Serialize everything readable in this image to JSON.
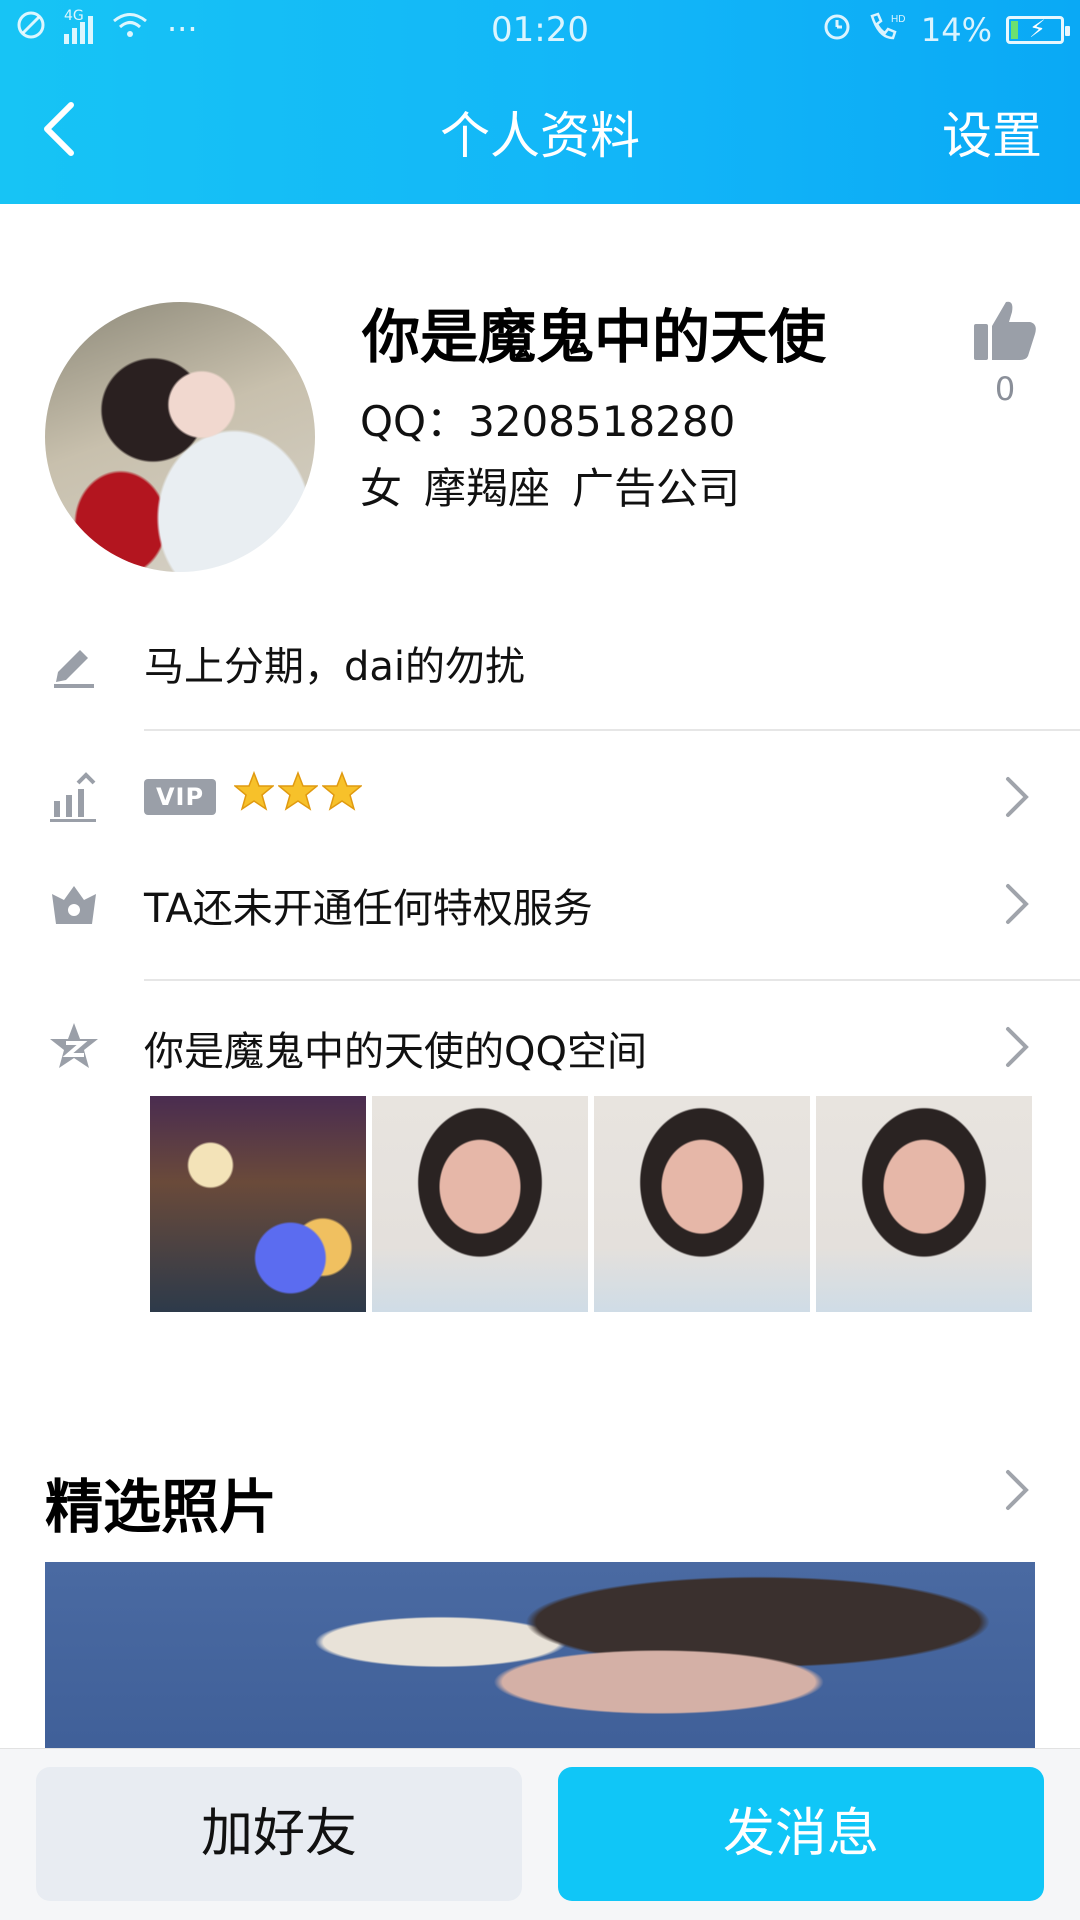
{
  "status_bar": {
    "network": "4G",
    "more": "···",
    "time": "01:20",
    "battery": "14%",
    "battery_level": 0.14
  },
  "nav": {
    "title": "个人资料",
    "settings": "设置"
  },
  "profile": {
    "name": "你是魔鬼中的天使",
    "qq": "QQ：3208518280",
    "gender": "女",
    "zodiac": "摩羯座",
    "occupation": "广告公司",
    "like_count": "0"
  },
  "signature": {
    "text": "马上分期，dai的勿扰"
  },
  "vip": {
    "badge": "VIP",
    "stars": 3
  },
  "privilege": {
    "text": "TA还未开通任何特权服务"
  },
  "qzone": {
    "text": "你是魔鬼中的天使的QQ空间"
  },
  "featured": {
    "title": "精选照片"
  },
  "actions": {
    "add_friend": "加好友",
    "send_message": "发消息"
  },
  "colors": {
    "header": "#12b5f8",
    "primary_button": "#10c6f7",
    "icon_gray": "#9a9fa8"
  }
}
